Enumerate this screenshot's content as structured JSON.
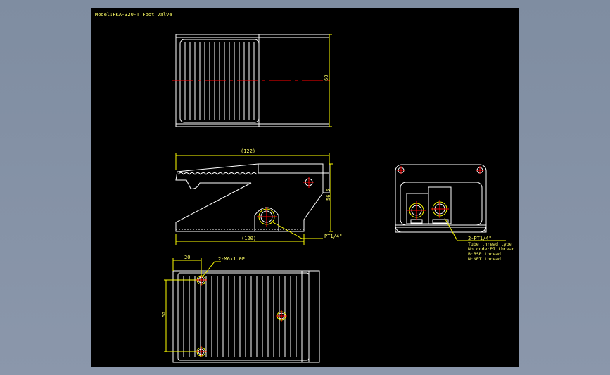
{
  "drawing": {
    "title": "Model:FKA-320-T Foot Valve",
    "dims": {
      "height_top": "60",
      "width_overall": "(122)",
      "height_side": "56.5",
      "base_length": "(120)",
      "mount_offset": "20",
      "mount_spacing": "52"
    },
    "notes": {
      "port_side": "PT1/4\"",
      "mount_holes": "2-M6x1.0P",
      "port_rear": "2-PT1/4\"",
      "tube_heading": "Tube thread type",
      "tube_opt1": "No code:PT thread",
      "tube_opt2": "B:BSP thread",
      "tube_opt3": "N:NPT thread"
    }
  },
  "colors": {
    "outline": "#ffffff",
    "dimension": "#ffff00",
    "centerline": "#ff0000",
    "background": "#000000"
  }
}
